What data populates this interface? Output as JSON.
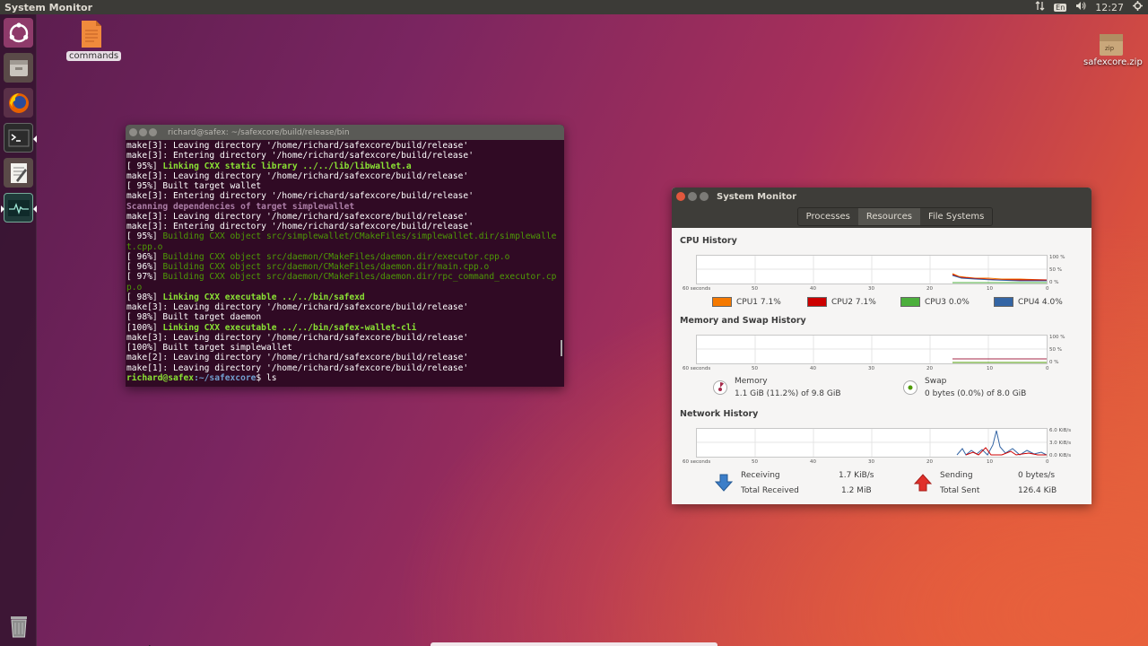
{
  "top_panel": {
    "app_title": "System Monitor",
    "language": "En",
    "time": "12:27"
  },
  "launcher": {
    "items": [
      {
        "name": "ubuntu-dash-icon"
      },
      {
        "name": "files-icon"
      },
      {
        "name": "firefox-icon"
      },
      {
        "name": "terminal-icon"
      },
      {
        "name": "text-editor-icon"
      },
      {
        "name": "system-monitor-icon"
      },
      {
        "name": "trash-icon"
      }
    ]
  },
  "desktop": {
    "commands_label": "commands",
    "zip_label": "safexcore.zip",
    "zip_badge": "zip"
  },
  "terminal": {
    "title": "richard@safex: ~/safexcore/build/release/bin",
    "lines": [
      {
        "t": "make[3]: Leaving directory '/home/richard/safexcore/build/release'",
        "s": "norm"
      },
      {
        "t": "make[3]: Entering directory '/home/richard/safexcore/build/release'",
        "s": "norm"
      },
      {
        "p": "[ 95%] ",
        "t": "Linking CXX static library ../../lib/libwallet.a",
        "s": "greenb"
      },
      {
        "t": "make[3]: Leaving directory '/home/richard/safexcore/build/release'",
        "s": "norm"
      },
      {
        "t": "[ 95%] Built target wallet",
        "s": "norm"
      },
      {
        "t": "make[3]: Entering directory '/home/richard/safexcore/build/release'",
        "s": "norm"
      },
      {
        "t": "Scanning dependencies of target simplewallet",
        "s": "magb"
      },
      {
        "t": "make[3]: Leaving directory '/home/richard/safexcore/build/release'",
        "s": "norm"
      },
      {
        "t": "make[3]: Entering directory '/home/richard/safexcore/build/release'",
        "s": "norm"
      },
      {
        "p": "[ 95%] ",
        "t": "Building CXX object src/simplewallet/CMakeFiles/simplewallet.dir/simplewallet.cpp.o",
        "s": "green"
      },
      {
        "p": "[ 96%] ",
        "t": "Building CXX object src/daemon/CMakeFiles/daemon.dir/executor.cpp.o",
        "s": "green"
      },
      {
        "p": "[ 96%] ",
        "t": "Building CXX object src/daemon/CMakeFiles/daemon.dir/main.cpp.o",
        "s": "green"
      },
      {
        "p": "[ 97%] ",
        "t": "Building CXX object src/daemon/CMakeFiles/daemon.dir/rpc_command_executor.cpp.o",
        "s": "green"
      },
      {
        "p": "[ 98%] ",
        "t": "Linking CXX executable ../../bin/safexd",
        "s": "greenb"
      },
      {
        "t": "make[3]: Leaving directory '/home/richard/safexcore/build/release'",
        "s": "norm"
      },
      {
        "t": "[ 98%] Built target daemon",
        "s": "norm"
      },
      {
        "p": "[100%] ",
        "t": "Linking CXX executable ../../bin/safex-wallet-cli",
        "s": "greenb"
      },
      {
        "t": "make[3]: Leaving directory '/home/richard/safexcore/build/release'",
        "s": "norm"
      },
      {
        "t": "[100%] Built target simplewallet",
        "s": "norm"
      },
      {
        "t": "make[2]: Leaving directory '/home/richard/safexcore/build/release'",
        "s": "norm"
      },
      {
        "t": "make[1]: Leaving directory '/home/richard/safexcore/build/release'",
        "s": "norm"
      }
    ],
    "prompt_user": "richard@safex",
    "prompt_path": ":~/safexcore",
    "prompt_cmd": "$ ls"
  },
  "sysmon": {
    "title": "System Monitor",
    "tabs": [
      "Processes",
      "Resources",
      "File Systems"
    ],
    "active_tab": 1,
    "x_ticks": [
      "60 seconds",
      "50",
      "40",
      "30",
      "20",
      "10",
      "0"
    ],
    "cpu": {
      "title": "CPU History",
      "y_ticks": [
        "100 %",
        "50 %",
        "0 %"
      ],
      "legend": [
        {
          "label": "CPU1",
          "value": "7.1%",
          "color": "#f57900"
        },
        {
          "label": "CPU2",
          "value": "7.1%",
          "color": "#cc0000"
        },
        {
          "label": "CPU3",
          "value": "0.0%",
          "color": "#4caf3c"
        },
        {
          "label": "CPU4",
          "value": "4.0%",
          "color": "#3465a4"
        }
      ]
    },
    "memory": {
      "title": "Memory and Swap History",
      "y_ticks": [
        "100 %",
        "50 %",
        "0 %"
      ],
      "mem_label": "Memory",
      "mem_detail": "1.1 GiB (11.2%) of 9.8 GiB",
      "mem_color": "#a52a4a",
      "swap_label": "Swap",
      "swap_detail": "0 bytes (0.0%) of 8.0 GiB",
      "swap_color": "#4e9a06"
    },
    "network": {
      "title": "Network History",
      "y_ticks": [
        "6.0 KiB/s",
        "3.0 KiB/s",
        "0.0 KiB/s"
      ],
      "receiving_label": "Receiving",
      "receiving_value": "1.7 KiB/s",
      "total_received_label": "Total Received",
      "total_received_value": "1.2 MiB",
      "sending_label": "Sending",
      "sending_value": "0 bytes/s",
      "total_sent_label": "Total Sent",
      "total_sent_value": "126.4 KiB"
    }
  }
}
